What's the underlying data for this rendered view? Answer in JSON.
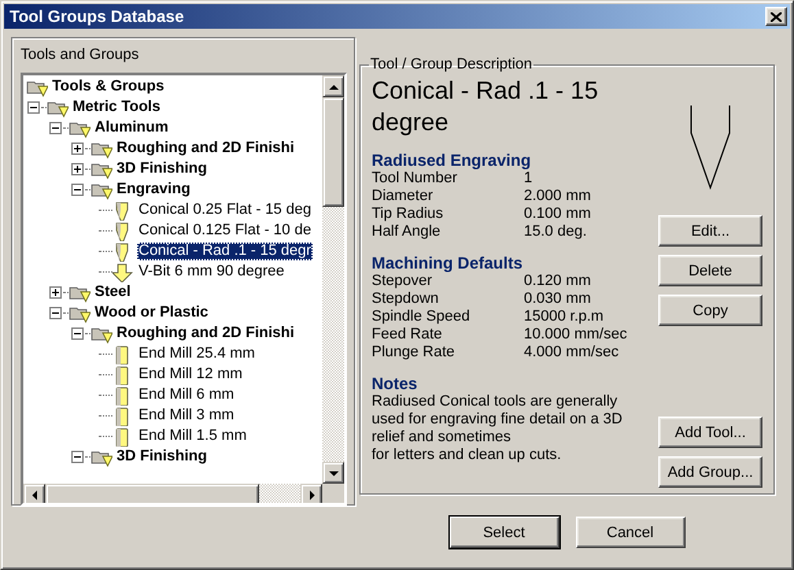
{
  "window": {
    "title": "Tool Groups Database"
  },
  "tree_panel": {
    "label": "Tools and Groups",
    "nodes": [
      {
        "kind": "group",
        "label": "Tools & Groups",
        "selected": false,
        "children": [
          {
            "kind": "group",
            "label": "Metric Tools",
            "expanded": true,
            "selected": false,
            "children": [
              {
                "kind": "group",
                "label": "Aluminum",
                "expanded": true,
                "selected": false,
                "children": [
                  {
                    "kind": "group",
                    "label": "Roughing and 2D Finishi",
                    "expanded": false,
                    "selected": false
                  },
                  {
                    "kind": "group",
                    "label": "3D Finishing",
                    "expanded": false,
                    "selected": false
                  },
                  {
                    "kind": "group",
                    "label": "Engraving",
                    "expanded": true,
                    "selected": false,
                    "children": [
                      {
                        "kind": "conical",
                        "label": "Conical 0.25 Flat - 15 deg",
                        "selected": false
                      },
                      {
                        "kind": "conical",
                        "label": "Conical 0.125 Flat - 10 de",
                        "selected": false
                      },
                      {
                        "kind": "conical",
                        "label": "Conical - Rad .1 - 15 degr",
                        "selected": true
                      },
                      {
                        "kind": "vbit",
                        "label": "V-Bit 6 mm 90 degree",
                        "selected": false
                      }
                    ]
                  }
                ]
              },
              {
                "kind": "group",
                "label": "Steel",
                "expanded": false,
                "selected": false
              },
              {
                "kind": "group",
                "label": "Wood or Plastic",
                "expanded": true,
                "selected": false,
                "children": [
                  {
                    "kind": "group",
                    "label": "Roughing and 2D Finishi",
                    "expanded": true,
                    "selected": false,
                    "children": [
                      {
                        "kind": "endmill",
                        "label": "End Mill 25.4 mm",
                        "selected": false
                      },
                      {
                        "kind": "endmill",
                        "label": "End Mill 12 mm",
                        "selected": false
                      },
                      {
                        "kind": "endmill",
                        "label": "End Mill 6 mm",
                        "selected": false
                      },
                      {
                        "kind": "endmill",
                        "label": "End Mill 3 mm",
                        "selected": false
                      },
                      {
                        "kind": "endmill",
                        "label": "End Mill 1.5 mm",
                        "selected": false
                      }
                    ]
                  },
                  {
                    "kind": "group",
                    "label": "3D Finishing",
                    "expanded": true,
                    "selected": false
                  }
                ]
              }
            ]
          }
        ]
      }
    ]
  },
  "description": {
    "legend": "Tool / Group Description",
    "title": "Conical - Rad .1 - 15 degree",
    "sections": [
      {
        "kind": "table",
        "heading": "Radiused Engraving",
        "rows": [
          {
            "label": "Tool Number",
            "value": "1"
          },
          {
            "label": "Diameter",
            "value": "2.000 mm"
          },
          {
            "label": "Tip Radius",
            "value": "0.100 mm"
          },
          {
            "label": "Half Angle",
            "value": "15.0 deg."
          }
        ]
      },
      {
        "kind": "table",
        "heading": "Machining Defaults",
        "rows": [
          {
            "label": "Stepover",
            "value": "0.120 mm"
          },
          {
            "label": "Stepdown",
            "value": "0.030 mm"
          },
          {
            "label": "Spindle Speed",
            "value": "15000 r.p.m"
          },
          {
            "label": "Feed Rate",
            "value": "10.000 mm/sec"
          },
          {
            "label": "Plunge Rate",
            "value": "4.000 mm/sec"
          }
        ]
      },
      {
        "kind": "notes",
        "heading": "Notes",
        "text": "Radiused Conical tools are generally used for engraving fine detail on a 3D relief and sometimes\nfor letters and clean up cuts."
      }
    ],
    "top_buttons": [
      "Edit...",
      "Delete",
      "Copy"
    ],
    "bottom_buttons": [
      "Add Tool...",
      "Add Group..."
    ]
  },
  "dialog_buttons": [
    {
      "label": "Select",
      "default": true
    },
    {
      "label": "Cancel",
      "default": false
    }
  ]
}
